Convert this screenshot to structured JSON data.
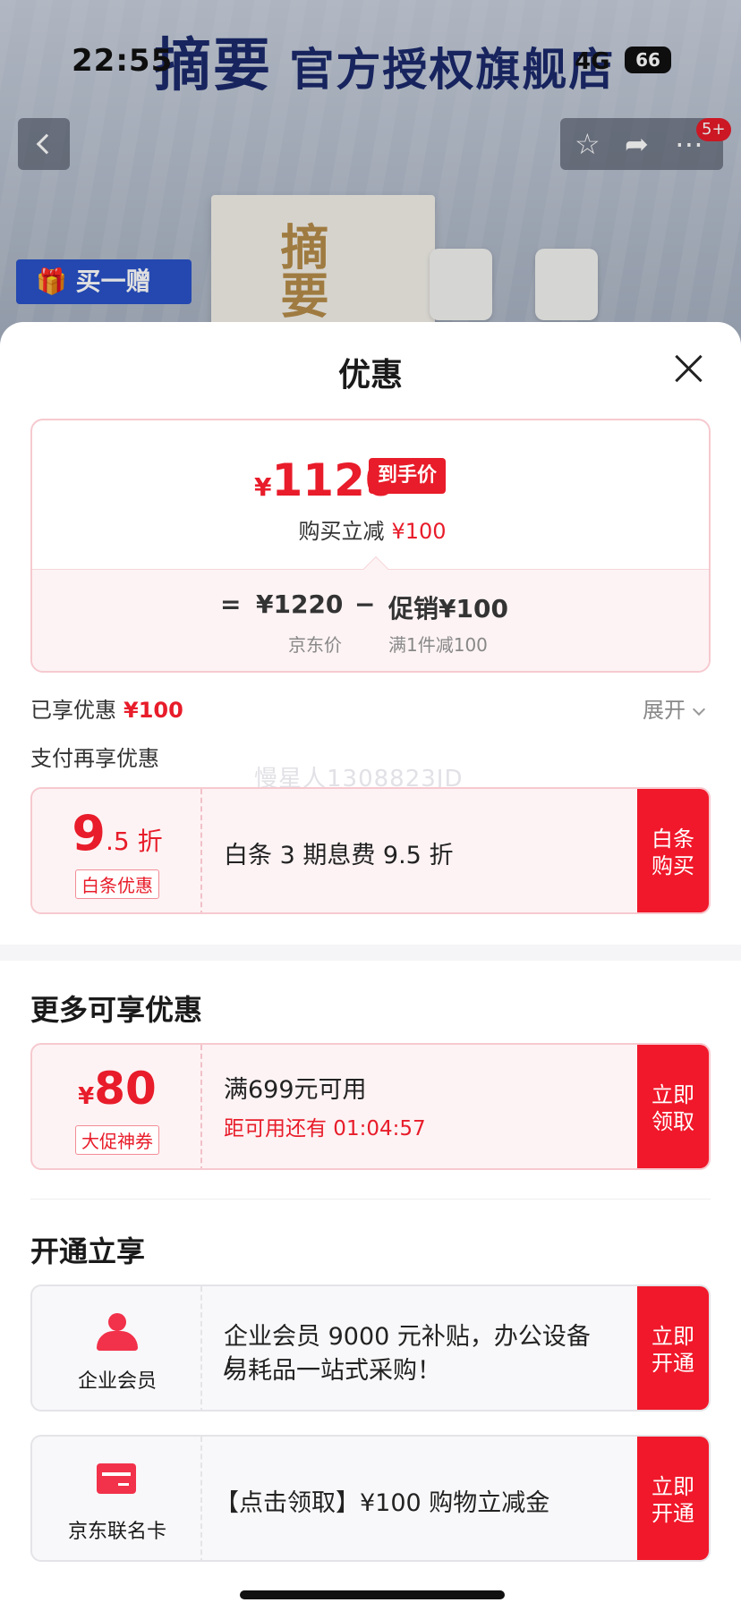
{
  "status_bar": {
    "time": "22:55",
    "network": "4G",
    "battery": "66"
  },
  "store_banner": {
    "brand": "摘要",
    "store_name": "官方授权旗舰店"
  },
  "top_nav": {
    "notification_badge": "5+"
  },
  "product_promo": {
    "label": "买一赠",
    "box_brand": "摘要"
  },
  "sheet": {
    "title": "优惠"
  },
  "price_card": {
    "currency": "¥",
    "final_price": "1120",
    "final_tag": "到手价",
    "instant_off_label": "购买立减",
    "instant_off_value": "¥100",
    "equals": "=",
    "jd_price": "¥1220",
    "minus": "−",
    "promo_label": "促销¥100",
    "jd_price_caption": "京东价",
    "promo_caption": "满1件减100"
  },
  "enjoyed": {
    "label": "已享优惠",
    "value": "¥100",
    "expand": "展开"
  },
  "pay_more": {
    "label": "支付再享优惠"
  },
  "watermark": "慢星人1308823JD",
  "baitiao_coupon": {
    "big": "9",
    "small": ".5 折",
    "tag": "白条优惠",
    "desc": "白条 3 期息费 9.5 折",
    "action": "白条购买"
  },
  "more_section": {
    "title": "更多可享优惠"
  },
  "promo_coupon": {
    "currency": "¥",
    "amount": "80",
    "tag": "大促神券",
    "desc": "满699元可用",
    "countdown": "距可用还有 01:04:57",
    "action": "立即领取"
  },
  "open_section": {
    "title": "开通立享"
  },
  "enterprise_card": {
    "icon": "user-icon",
    "label": "企业会员",
    "desc_line1": "企业会员 9000 元补贴，办公设备 /",
    "desc_line2": "易耗品一站式采购！",
    "action": "立即开通"
  },
  "jd_card": {
    "icon": "credit-card-icon",
    "label": "京东联名卡",
    "desc": "【点击领取】¥100 购物立减金",
    "action": "立即开通"
  },
  "colors": {
    "accent": "#e81c2a",
    "action": "#f0182a",
    "pink_bg": "#fdf3f4"
  }
}
